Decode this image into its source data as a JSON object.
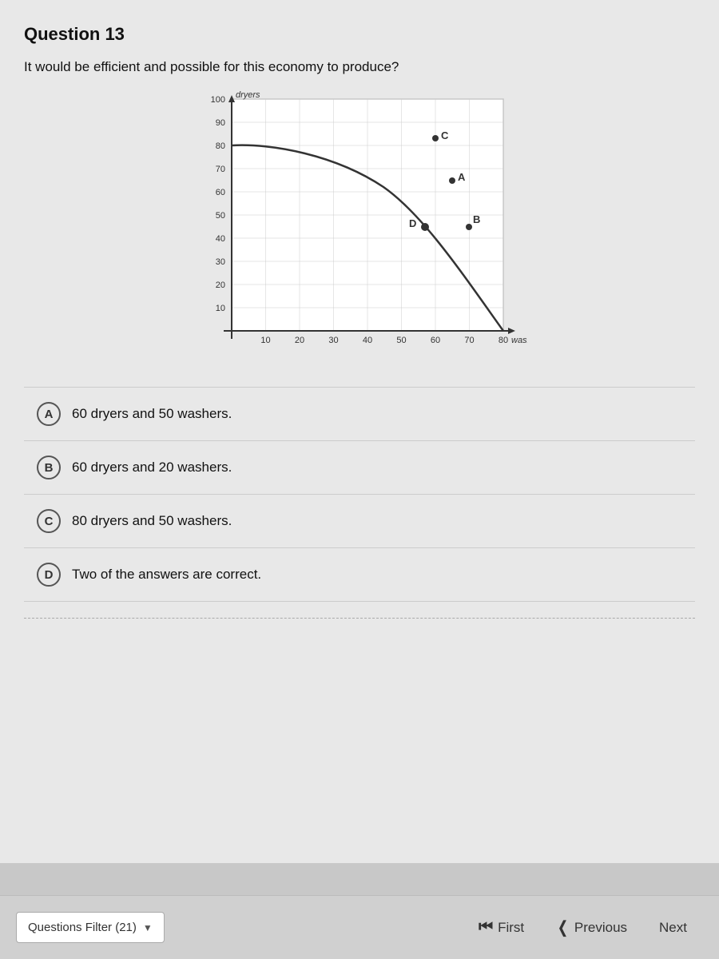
{
  "page": {
    "question_number": "Question 13",
    "question_text": "It would be efficient and possible for this economy to produce?",
    "chart": {
      "x_axis_label": "washers",
      "y_axis_label": "dryers",
      "x_max": 80,
      "y_max": 100,
      "points": {
        "A": {
          "x": 65,
          "y": 65
        },
        "B": {
          "x": 70,
          "y": 45
        },
        "C": {
          "x": 65,
          "y": 83
        },
        "D": {
          "x": 57,
          "y": 45
        }
      }
    },
    "options": [
      {
        "id": "A",
        "text": "60 dryers and 50 washers."
      },
      {
        "id": "B",
        "text": "60 dryers and 20 washers."
      },
      {
        "id": "C",
        "text": "80 dryers and 50 washers."
      },
      {
        "id": "D",
        "text": "Two of the answers are correct."
      }
    ],
    "footer": {
      "filter_label": "Questions Filter (21)",
      "first_label": "First",
      "previous_label": "Previous",
      "next_label": "Next"
    }
  }
}
